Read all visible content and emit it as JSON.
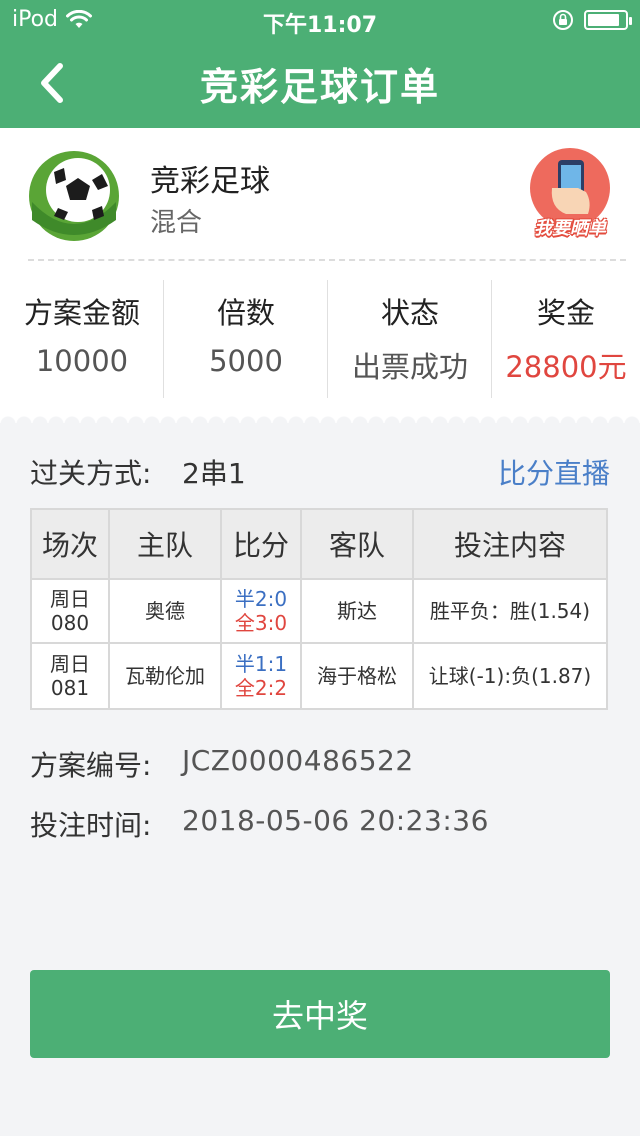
{
  "status_bar": {
    "carrier": "iPod",
    "time": "下午11:07",
    "battery_level": 0.85
  },
  "nav": {
    "title": "竞彩足球订单"
  },
  "lottery": {
    "name": "竞彩足球",
    "subtype": "混合",
    "share_label": "我要晒单"
  },
  "stats": [
    {
      "label": "方案金额",
      "value": "10000"
    },
    {
      "label": "倍数",
      "value": "5000"
    },
    {
      "label": "状态",
      "value": "出票成功"
    },
    {
      "label": "奖金",
      "value": "28800元"
    }
  ],
  "guoguan": {
    "label": "过关方式:",
    "value": "2串1",
    "live_link": "比分直播"
  },
  "table": {
    "headers": [
      "场次",
      "主队",
      "比分",
      "客队",
      "投注内容"
    ],
    "rows": [
      {
        "match_day": "周日",
        "match_no": "080",
        "home": "奥德",
        "half_score": "半2:0",
        "full_score": "全3:0",
        "away": "斯达",
        "bet": "胜平负：胜(1.54)"
      },
      {
        "match_day": "周日",
        "match_no": "081",
        "home": "瓦勒伦加",
        "half_score": "半1:1",
        "full_score": "全2:2",
        "away": "海于格松",
        "bet": "让球(-1):负(1.87)"
      }
    ]
  },
  "scheme": {
    "id_label": "方案编号:",
    "id_value": "JCZ0000486522",
    "time_label": "投注时间:",
    "time_value": "2018-05-06 20:23:36"
  },
  "action": {
    "button_label": "去中奖"
  },
  "colors": {
    "brand_green": "#4caf75",
    "prize_red": "#e0463f",
    "link_blue": "#4a7fc8"
  }
}
